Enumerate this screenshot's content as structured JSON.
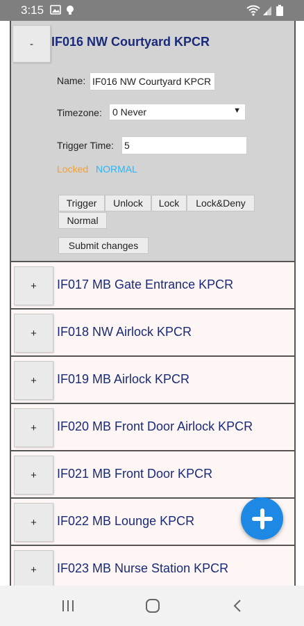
{
  "status_bar": {
    "time": "3:15",
    "icons": [
      "image-icon",
      "lightbulb-icon",
      "wifi-icon",
      "signal-icon",
      "battery-icon"
    ]
  },
  "expanded_item": {
    "toggle": "-",
    "title": "IF016 NW Courtyard KPCR",
    "name_label": "Name:",
    "name_value": "IF016 NW Courtyard KPCR",
    "timezone_label": "Timezone:",
    "timezone_value": "0 Never",
    "trigger_time_label": "Trigger Time:",
    "trigger_time_value": "5",
    "lock_state": "Locked",
    "mode_state": "NORMAL",
    "buttons": {
      "trigger": "Trigger",
      "unlock": "Unlock",
      "lock": "Lock",
      "lock_deny": "Lock&Deny",
      "normal": "Normal"
    },
    "submit": "Submit changes"
  },
  "items": [
    {
      "toggle": "+",
      "title": "IF017 MB Gate Entrance KPCR"
    },
    {
      "toggle": "+",
      "title": "IF018 NW Airlock KPCR"
    },
    {
      "toggle": "+",
      "title": "IF019 MB Airlock KPCR"
    },
    {
      "toggle": "+",
      "title": "IF020 MB Front Door Airlock KPCR"
    },
    {
      "toggle": "+",
      "title": "IF021 MB Front Door KPCR"
    },
    {
      "toggle": "+",
      "title": "IF022 MB Lounge KPCR"
    },
    {
      "toggle": "+",
      "title": "IF023 MB Nurse Station KPCR"
    }
  ],
  "colors": {
    "title": "#1a2a7a",
    "locked": "#f5a030",
    "normal": "#29b6f6",
    "fab": "#1e88e5",
    "panel": "#d3d3d3",
    "row_bg": "#fdf6f4"
  },
  "fab": {
    "icon": "plus-icon"
  }
}
